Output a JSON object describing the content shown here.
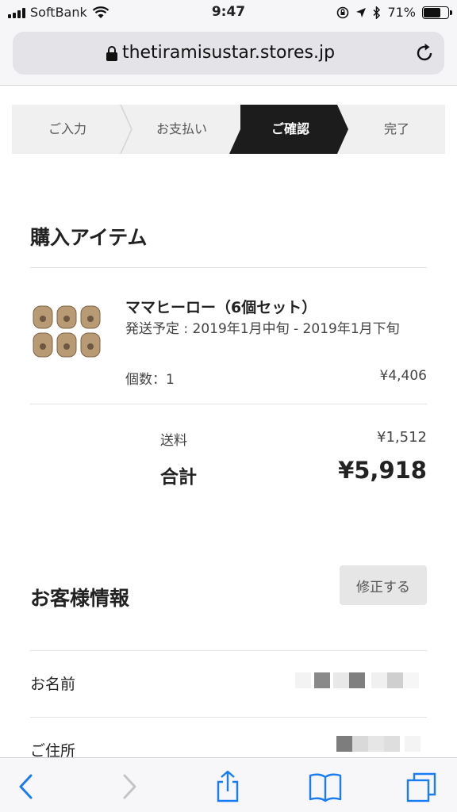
{
  "status_bar": {
    "carrier": "SoftBank",
    "time": "9:47",
    "battery": "71%",
    "battery_level": 0.71
  },
  "browser": {
    "url": "thetiramisustar.stores.jp"
  },
  "steps": [
    {
      "label": "ご入力",
      "active": false
    },
    {
      "label": "お支払い",
      "active": false
    },
    {
      "label": "ご確認",
      "active": true
    },
    {
      "label": "完了",
      "active": false
    }
  ],
  "purchase": {
    "title": "購入アイテム",
    "item": {
      "name": "ママヒーロー（6個セット）",
      "shipping_schedule": "発送予定 : 2019年1月中旬 - 2019年1月下旬",
      "quantity": "個数：1",
      "price": "¥4,406"
    },
    "shipping_label": "送料",
    "shipping_value": "¥1,512",
    "total_label": "合計",
    "total_value": "¥5,918"
  },
  "customer": {
    "title": "お客様情報",
    "edit_label": "修正する",
    "name_label": "お名前",
    "address_label": "ご住所"
  },
  "colors": {
    "active_step": "#1c1c1c",
    "step_bg": "#f0f0f0",
    "ios_blue": "#1a7cf5"
  },
  "icons": [
    "lock-icon",
    "reload-icon",
    "back-icon",
    "forward-icon",
    "share-icon",
    "bookmarks-icon",
    "tabs-icon"
  ]
}
